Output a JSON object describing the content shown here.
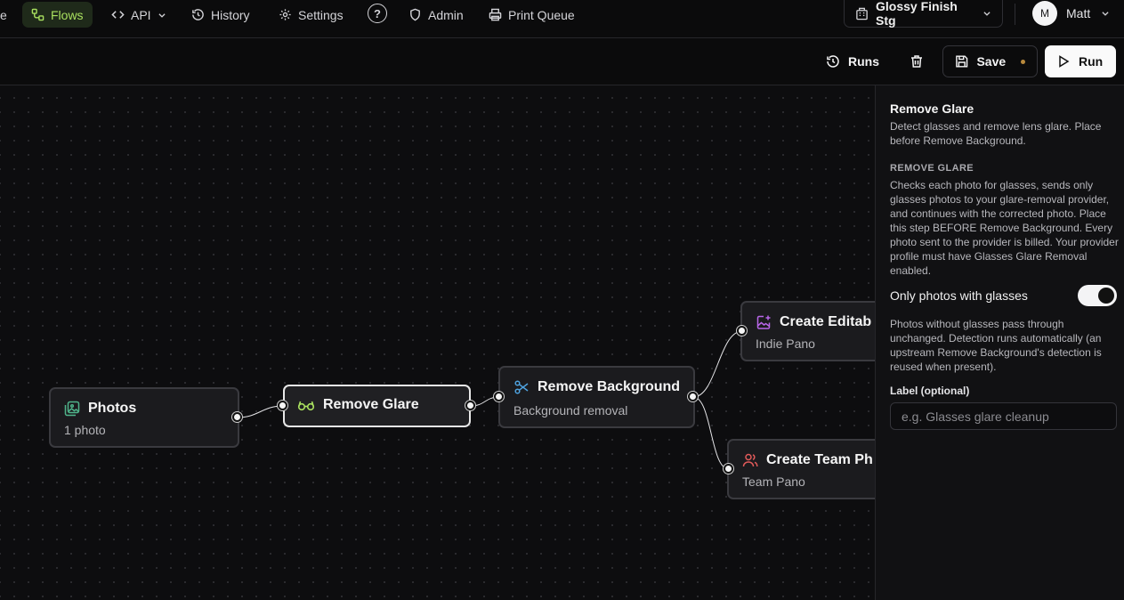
{
  "nav": {
    "partial_left": "e",
    "flows": "Flows",
    "api": "API",
    "history": "History",
    "settings": "Settings",
    "help": "?",
    "admin": "Admin",
    "print_queue": "Print Queue",
    "workspace": "Glossy Finish Stg",
    "user_initial": "M",
    "user_name": "Matt",
    "accent_color": "#a9e05f"
  },
  "toolbar": {
    "runs": "Runs",
    "save": "Save",
    "run": "Run",
    "unsaved_dot_color": "#b8893c"
  },
  "nodes": {
    "photos": {
      "title": "Photos",
      "subtitle": "1 photo",
      "icon": "image-stack-icon"
    },
    "remove_glare": {
      "title": "Remove Glare",
      "icon": "glasses-icon",
      "selected": true
    },
    "remove_background": {
      "title": "Remove Background",
      "subtitle": "Background removal",
      "icon": "scissors-icon"
    },
    "create_editable": {
      "title": "Create Editab",
      "subtitle": "Indie Pano",
      "icon": "image-sparkle-icon"
    },
    "create_team": {
      "title": "Create Team Ph",
      "subtitle": "Team Pano",
      "icon": "users-icon"
    }
  },
  "panel": {
    "title": "Remove Glare",
    "description": "Detect glasses and remove lens glare. Place before Remove Background.",
    "section_heading": "REMOVE GLARE",
    "body": "Checks each photo for glasses, sends only glasses photos to your glare-removal provider, and continues with the corrected photo. Place this step BEFORE Remove Background. Every photo sent to the provider is billed. Your provider profile must have Glasses Glare Removal enabled.",
    "toggle_label": "Only photos with glasses",
    "toggle_on": true,
    "note": "Photos without glasses pass through unchanged. Detection runs automatically (an upstream Remove Background's detection is reused when present).",
    "field_label": "Label (optional)",
    "field_value": "",
    "field_placeholder": "e.g. Glasses glare cleanup"
  }
}
